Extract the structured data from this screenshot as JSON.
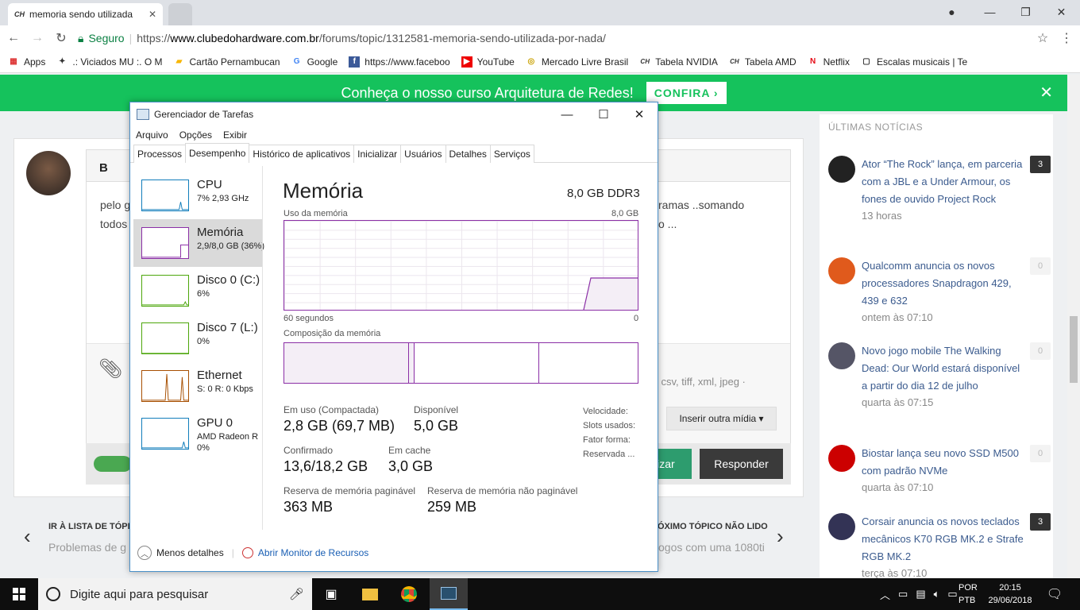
{
  "browser": {
    "tab_title": "memoria sendo utilizada",
    "tab_favicon": "CH",
    "secure_label": "Seguro",
    "url_prefix": "https://",
    "url_domain": "www.clubedohardware.com.br",
    "url_path": "/forums/topic/1312581-memoria-sendo-utilizada-por-nada/",
    "bookmarks": [
      {
        "label": "Apps",
        "icon": "apps-grid-icon"
      },
      {
        "label": ".: Viciados MU :. O M",
        "icon": "mu-icon"
      },
      {
        "label": "Cartão Pernambucan",
        "icon": "card-icon"
      },
      {
        "label": "Google",
        "icon": "google-icon"
      },
      {
        "label": "https://www.faceboo",
        "icon": "facebook-icon"
      },
      {
        "label": "YouTube",
        "icon": "youtube-icon"
      },
      {
        "label": "Mercado Livre Brasil",
        "icon": "mercadolivre-icon"
      },
      {
        "label": "Tabela NVIDIA",
        "icon": "ch-icon"
      },
      {
        "label": "Tabela AMD",
        "icon": "ch-icon"
      },
      {
        "label": "Netflix",
        "icon": "netflix-icon"
      },
      {
        "label": "Escalas musicais | Te",
        "icon": "page-icon"
      }
    ]
  },
  "banner": {
    "text": "Conheça o nosso curso Arquitetura de Redes!",
    "button": "CONFIRA ›",
    "color": "#15c25c"
  },
  "forum": {
    "editor_bold": "B",
    "post_text_line1_left": "pelo g",
    "post_text_line2_left": "todos",
    "post_text_line1_right": "ramas ..somando",
    "post_text_line2_right": "o ...",
    "file_types": "o, csv, tiff, xml, jpeg ·",
    "insert_media": "Inserir outra mídia ▾",
    "save_button": "lizar",
    "reply_button": "Responder",
    "prev_label": "IR À LISTA DE TÓPI",
    "prev_title": "Problemas de g",
    "next_label": "ÓXIMO TÓPICO NÃO LIDO",
    "next_title": "ogos com uma 1080ti"
  },
  "sidebar": {
    "title": "ÚLTIMAS NOTÍCIAS",
    "news": [
      {
        "title": "Ator “The Rock” lança, em parceria com a JBL e a Under Armour, os fones de ouvido Project Rock",
        "time": "13 horas",
        "count": "3",
        "style": "dark"
      },
      {
        "title": "Qualcomm anuncia os novos processadores Snapdragon 429, 439 e 632",
        "time": "ontem às 07:10",
        "count": "0",
        "style": "light"
      },
      {
        "title": "Novo jogo mobile The Walking Dead: Our World estará disponível a partir do dia 12 de julho",
        "time": "quarta às 07:15",
        "count": "0",
        "style": "light"
      },
      {
        "title": "Biostar lança seu novo SSD M500 com padrão NVMe",
        "time": "quarta às 07:10",
        "count": "0",
        "style": "light"
      },
      {
        "title": "Corsair anuncia os novos teclados mecânicos K70 RGB MK.2 e Strafe RGB MK.2",
        "time": "terça às 07:10",
        "count": "3",
        "style": "dark"
      }
    ]
  },
  "taskmanager": {
    "title": "Gerenciador de Tarefas",
    "menu": [
      "Arquivo",
      "Opções",
      "Exibir"
    ],
    "tabs": [
      "Processos",
      "Desempenho",
      "Histórico de aplicativos",
      "Inicializar",
      "Usuários",
      "Detalhes",
      "Serviços"
    ],
    "active_tab": "Desempenho",
    "resources": [
      {
        "name": "CPU",
        "sub": "7% 2,93 GHz",
        "color": "#117dbb"
      },
      {
        "name": "Memória",
        "sub": "2,9/8,0 GB (36%)",
        "color": "#8b2fa6"
      },
      {
        "name": "Disco 0 (C:)",
        "sub": "6%",
        "color": "#4da60c"
      },
      {
        "name": "Disco 7 (L:)",
        "sub": "0%",
        "color": "#4da60c"
      },
      {
        "name": "Ethernet",
        "sub": "S: 0 R: 0 Kbps",
        "color": "#a74f01"
      },
      {
        "name": "GPU 0",
        "sub": "AMD Radeon R",
        "sub2": "0%",
        "color": "#117dbb"
      }
    ],
    "memory": {
      "title": "Memória",
      "total": "8,0 GB DDR3",
      "usage_label": "Uso da memória",
      "usage_max": "8,0 GB",
      "time_left": "60 segundos",
      "time_right": "0",
      "composition_label": "Composição da memória",
      "stats": {
        "in_use_label": "Em uso (Compactada)",
        "in_use_value": "2,8 GB (69,7 MB)",
        "available_label": "Disponível",
        "available_value": "5,0 GB",
        "committed_label": "Confirmado",
        "committed_value": "13,6/18,2 GB",
        "cached_label": "Em cache",
        "cached_value": "3,0 GB",
        "paged_label": "Reserva de memória paginável",
        "paged_value": "363 MB",
        "nonpaged_label": "Reserva de memória não paginável",
        "nonpaged_value": "259 MB"
      },
      "right_labels": [
        "Velocidade:",
        "Slots usados:",
        "Fator forma:",
        "Reservada ..."
      ]
    },
    "fewer_details": "Menos detalhes",
    "resource_monitor": "Abrir Monitor de Recursos"
  },
  "taskbar": {
    "search_placeholder": "Digite aqui para pesquisar",
    "lang1": "POR",
    "lang2": "PTB",
    "time": "20:15",
    "date": "29/06/2018"
  }
}
